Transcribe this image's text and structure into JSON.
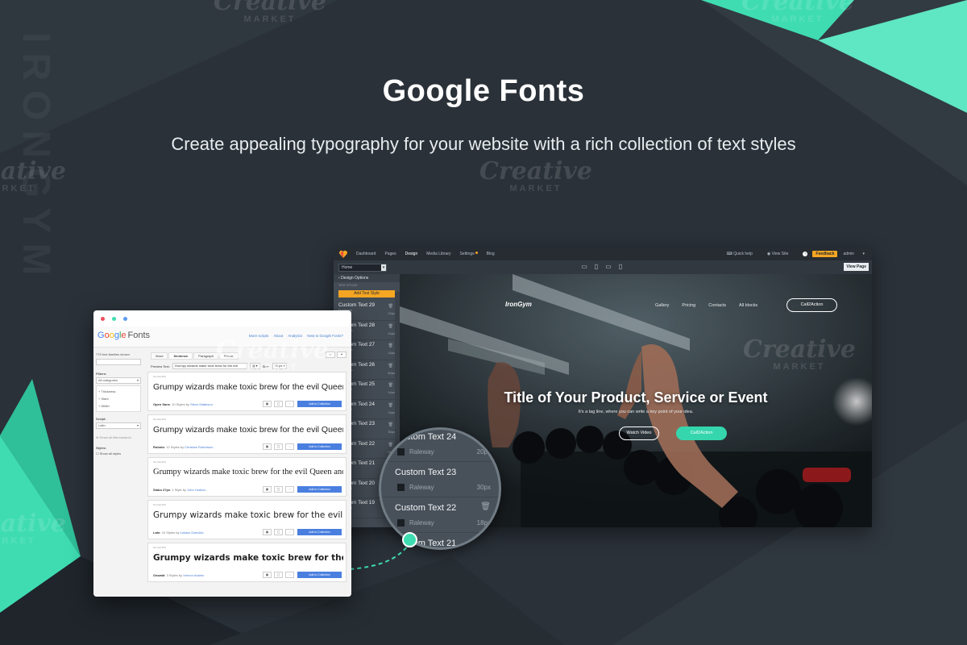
{
  "promo": {
    "title": "Google Fonts",
    "subtitle": "Create appealing typography for your website with a rich collection of text styles"
  },
  "watermarks": [
    {
      "brand": "Creative",
      "sub": "MARKET"
    },
    {
      "brand": "Creative",
      "sub": "MARKET"
    },
    {
      "brand": "Creative",
      "sub": "MARKET"
    },
    {
      "brand": "Creative",
      "sub": "MARKET"
    },
    {
      "brand": "Creative",
      "sub": "MARKET"
    },
    {
      "brand": "Creative",
      "sub": "MARKET"
    },
    {
      "brand": "Creative",
      "sub": "MARKET"
    }
  ],
  "vertical_brand": "IRONGYM",
  "colors": {
    "accent": "#3fdcb2",
    "background": "#2a3138",
    "builder_orange": "#f5a623",
    "gf_blue": "#4a7fe0"
  },
  "builder": {
    "nav": [
      "Dashboard",
      "Pages",
      "Design",
      "Media Library",
      "Settings",
      "Blog"
    ],
    "active_nav": "Design",
    "right": {
      "quick_help": "Quick help",
      "view_site": "View Site",
      "help": "?",
      "feedback": "Feedback",
      "user": "admin"
    },
    "page_select": "Home",
    "view_page": "View Page",
    "devices": [
      "desktop-icon",
      "tablet-icon",
      "tablet-landscape-icon",
      "phone-icon"
    ],
    "panel": {
      "header": "Design Options",
      "subheader": "TEXT STYLES",
      "add_button": "Add Text Style",
      "items": [
        {
          "name": "Custom Text 29",
          "font": "Montserrat",
          "size": "12px"
        },
        {
          "name": "Custom Text 28",
          "font": "Open Sans",
          "size": "14px"
        },
        {
          "name": "Custom Text 27",
          "font": "Open Sans",
          "size": "14px"
        },
        {
          "name": "Custom Text 26",
          "font": "Open Sans",
          "size": "60px"
        },
        {
          "name": "Custom Text 25",
          "font": "Montserrat",
          "size": "14px"
        },
        {
          "name": "Custom Text 24",
          "font": "Montserrat",
          "size": "14px"
        },
        {
          "name": "Custom Text 23",
          "font": "Raleway",
          "size": "30px"
        },
        {
          "name": "Custom Text 22",
          "font": "Raleway",
          "size": "18px"
        },
        {
          "name": "Custom Text 21",
          "font": "Raleway",
          "size": "18px"
        },
        {
          "name": "Custom Text 20",
          "font": "Montserrat",
          "size": "14px"
        },
        {
          "name": "Custom Text 19",
          "font": "Montserrat",
          "size": "14px"
        }
      ]
    },
    "site": {
      "logo": "IronGym",
      "nav": [
        "Gallery",
        "Pricing",
        "Contacts",
        "All blocks"
      ],
      "cta": "Call2Action",
      "hero_title": "Title of Your Product, Service or Event",
      "hero_tag": "It's a tag line, where you can write a key point of your idea.",
      "watch_video": "Watch Video",
      "hero_cta": "Call2Action"
    }
  },
  "magnifier": [
    {
      "name": "Custom Text 24",
      "font": "Raleway",
      "size": "20px"
    },
    {
      "name": "Custom Text 23",
      "font": "Raleway",
      "size": "30px"
    },
    {
      "name": "Custom Text 22",
      "font": "Raleway",
      "size": "18px"
    },
    {
      "name": "Custom Text 21",
      "font": "",
      "size": ""
    }
  ],
  "google_fonts": {
    "logo_google": "Google",
    "logo_fonts": "Fonts",
    "links": [
      "More scripts",
      "About",
      "Analytics",
      "New to Google Fonts?"
    ],
    "sidebar": {
      "count": "779 font families shown",
      "filters_label": "Filters:",
      "category": "All categories",
      "filters": [
        "+ Thickness",
        "+ Slant",
        "+ Width"
      ],
      "script_label": "Script:",
      "script": "Latin",
      "reset": "Reset all filters/search",
      "styles_label": "Styles:",
      "show_styles": "Show all styles"
    },
    "tabs": [
      "Word",
      "Sentence",
      "Paragraph",
      "Poster"
    ],
    "active_tab": "Sentence",
    "preview": {
      "label": "Preview Text:",
      "value": "Grumpy wizards make toxic brew for the evil",
      "size": "Size:",
      "size_value": "28 px"
    },
    "cards": [
      {
        "id": "Normal 400",
        "sample": "Grumpy wizards make toxic brew for the evil Queen and Jack.",
        "family": "Open Sans",
        "styles": "10 Styles by",
        "author": "Steve Matteson",
        "sample_font": "\"Liberation Sans\", sans-serif",
        "weight": "normal"
      },
      {
        "id": "Normal 400",
        "sample": "Grumpy wizards make toxic brew for the evil Queen and Jack.",
        "family": "Roboto",
        "styles": "12 Styles by",
        "author": "Christian Robertson",
        "sample_font": "\"Liberation Sans\", sans-serif",
        "weight": "normal"
      },
      {
        "id": "Normal 400",
        "sample": "Grumpy wizards make toxic brew for the evil Queen and Jack.",
        "family": "Slabo 27px",
        "styles": "1 Style by",
        "author": "John Hudson",
        "sample_font": "\"Liberation Serif\", serif",
        "weight": "normal"
      },
      {
        "id": "Normal 400",
        "sample": "Grumpy wizards make toxic brew for the evil Queen and Jack.",
        "family": "Lato",
        "styles": "10 Styles by",
        "author": "Łukasz Dziedzic",
        "sample_font": "\"DejaVu Sans\", sans-serif",
        "weight": "normal"
      },
      {
        "id": "Normal 400",
        "sample": "Grumpy wizards make toxic brew for the evil Queen and Jack.",
        "family": "Oswald",
        "styles": "3 Styles by",
        "author": "Vernon Adams",
        "sample_font": "\"DejaVu Sans\", sans-serif",
        "weight": "bold"
      }
    ],
    "add_label": "Add to Collection"
  }
}
